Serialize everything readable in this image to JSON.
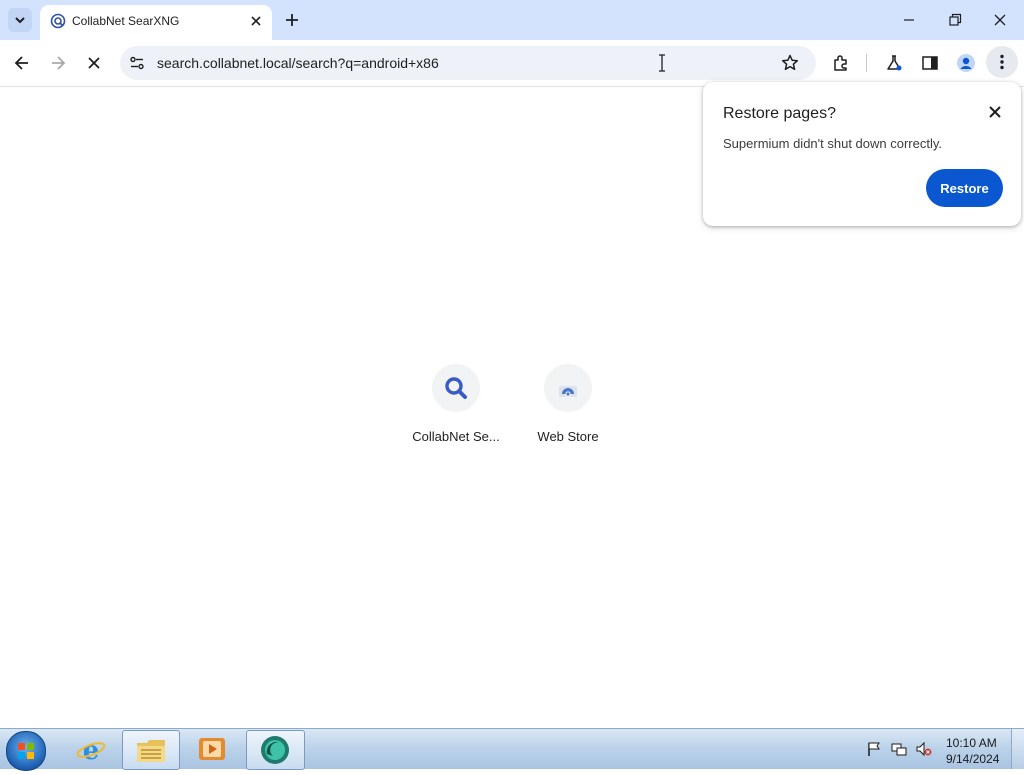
{
  "browser": {
    "tab": {
      "title": "CollabNet SearXNG"
    },
    "omnibox": {
      "url": "search.collabnet.local/search?q=android+x86"
    }
  },
  "restore_popup": {
    "title": "Restore pages?",
    "message": "Supermium didn't shut down correctly.",
    "button_label": "Restore"
  },
  "shortcuts": [
    {
      "label": "CollabNet Se...",
      "icon": "search-icon"
    },
    {
      "label": "Web Store",
      "icon": "web-store-icon"
    }
  ],
  "taskbar": {
    "apps": [
      "start-button",
      "internet-explorer-icon",
      "file-explorer-icon",
      "media-player-icon",
      "browser-icon"
    ],
    "tray_icons": [
      "action-center-flag-icon",
      "network-icon",
      "volume-muted-icon"
    ],
    "clock": {
      "time": "10:10 AM",
      "date": "9/14/2024"
    }
  },
  "colors": {
    "tabstrip": "#d3e3fd",
    "accent": "#0b57d0",
    "omnibox": "#eef2f8"
  }
}
